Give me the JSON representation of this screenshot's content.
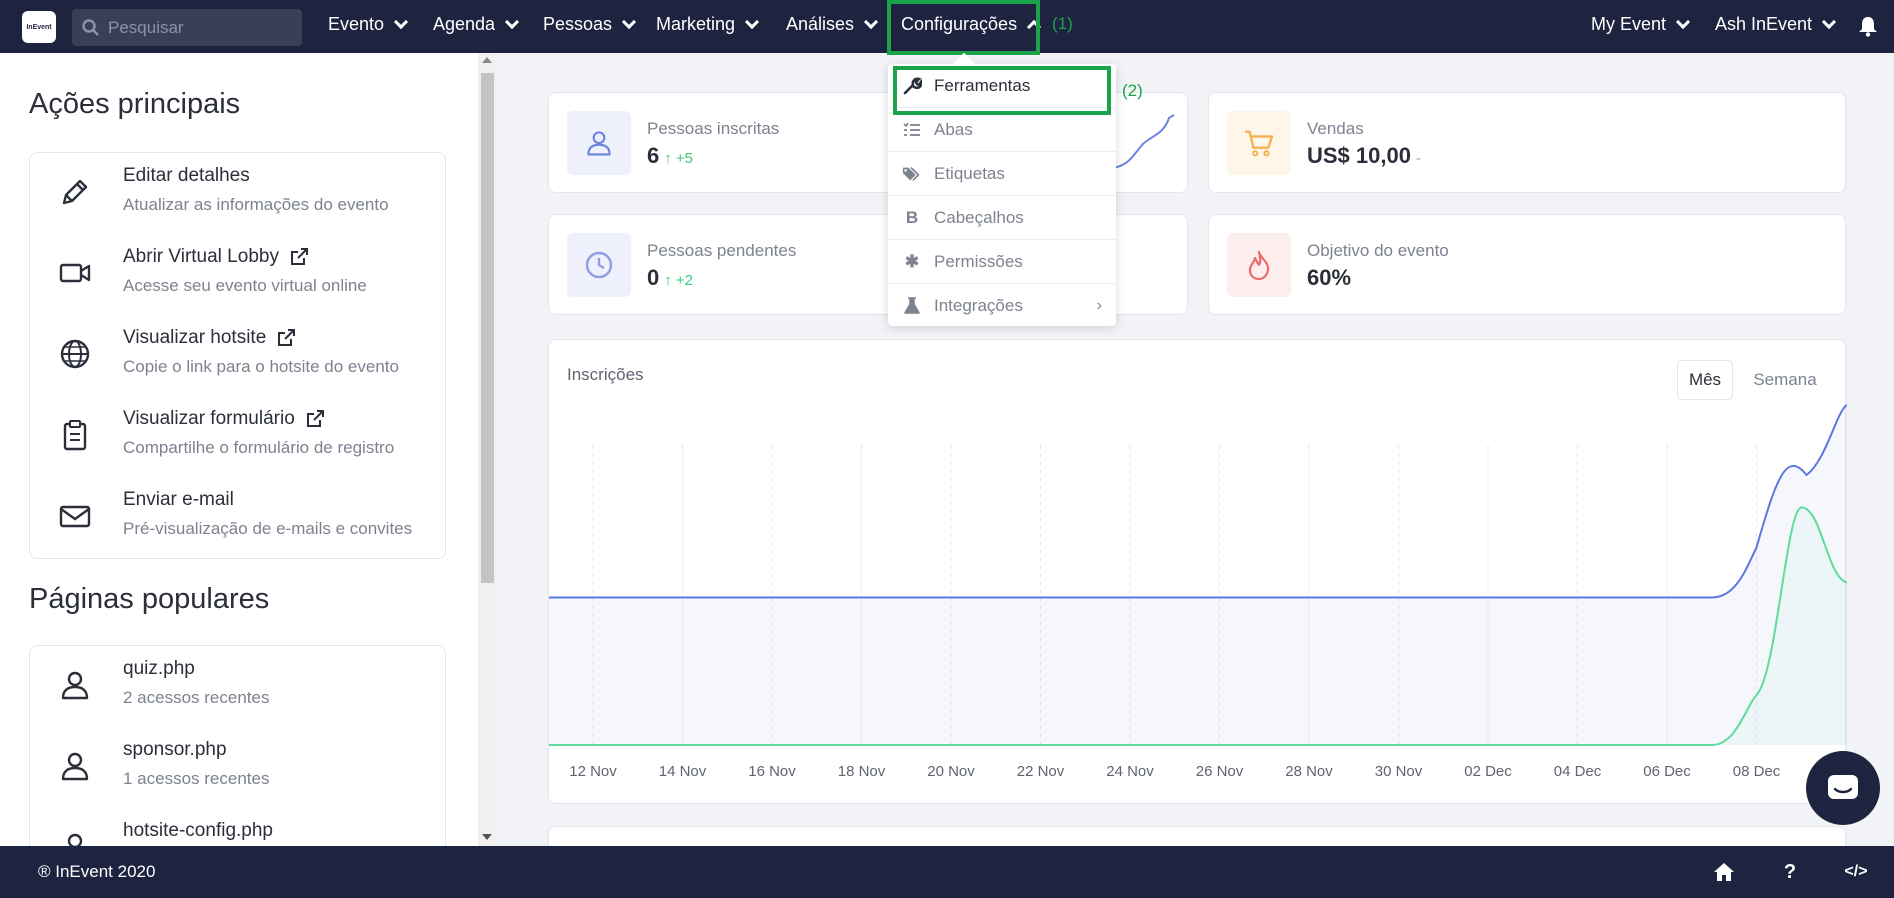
{
  "nav": {
    "search_placeholder": "Pesquisar",
    "items": [
      "Evento",
      "Agenda",
      "Pessoas",
      "Marketing",
      "Análises",
      "Configurações"
    ],
    "right_items": [
      "My Event",
      "Ash InEvent"
    ],
    "annotation_1": "(1)",
    "annotation_2": "(2)"
  },
  "dropdown": {
    "items": [
      {
        "label": "Ferramentas",
        "icon": "wrench-icon"
      },
      {
        "label": "Abas",
        "icon": "list-icon"
      },
      {
        "label": "Etiquetas",
        "icon": "tags-icon"
      },
      {
        "label": "Cabeçalhos",
        "icon": "bold-icon"
      },
      {
        "label": "Permissões",
        "icon": "asterisk-icon"
      },
      {
        "label": "Integrações",
        "icon": "flask-icon"
      }
    ]
  },
  "left": {
    "main_actions_title": "Ações principais",
    "actions": [
      {
        "title": "Editar detalhes",
        "subtitle": "Atualizar as informações do evento"
      },
      {
        "title": "Abrir Virtual Lobby",
        "subtitle": "Acesse seu evento virtual online"
      },
      {
        "title": "Visualizar hotsite",
        "subtitle": "Copie o link para o hotsite do evento"
      },
      {
        "title": "Visualizar formulário",
        "subtitle": "Compartilhe o formulário de registro"
      },
      {
        "title": "Enviar e-mail",
        "subtitle": "Pré-visualização de e-mails e convites"
      }
    ],
    "popular_title": "Páginas populares",
    "popular": [
      {
        "title": "quiz.php",
        "subtitle": "2 acessos recentes"
      },
      {
        "title": "sponsor.php",
        "subtitle": "1 acessos recentes"
      },
      {
        "title": "hotsite-config.php",
        "subtitle": ""
      }
    ]
  },
  "stats": {
    "inscritas": {
      "label": "Pessoas inscritas",
      "value": "6",
      "delta": "+5"
    },
    "vendas": {
      "label": "Vendas",
      "value": "US$ 10,00",
      "delta": "-"
    },
    "pendentes": {
      "label": "Pessoas pendentes",
      "value": "0",
      "delta": "+2"
    },
    "objetivo": {
      "label": "Objetivo do evento",
      "value": "60%"
    }
  },
  "chart": {
    "title": "Inscrições",
    "btn_month": "Mês",
    "btn_week": "Semana"
  },
  "chart_data": {
    "type": "area",
    "categories": [
      "12 Nov",
      "14 Nov",
      "16 Nov",
      "18 Nov",
      "20 Nov",
      "22 Nov",
      "24 Nov",
      "26 Nov",
      "28 Nov",
      "30 Nov",
      "02 Dec",
      "04 Dec",
      "06 Dec",
      "08 Dec"
    ],
    "series": [
      {
        "color": "#5b78e0",
        "values": [
          1,
          1,
          1,
          1,
          1,
          1,
          1,
          1,
          1,
          1,
          1,
          1,
          1,
          2
        ]
      },
      {
        "color": "#5fdc9c",
        "values": [
          0,
          0,
          0,
          0,
          0,
          0,
          0,
          0,
          0,
          0,
          0,
          0,
          0,
          1
        ]
      }
    ],
    "grid": true
  },
  "footer": {
    "copyright": "® InEvent 2020"
  }
}
